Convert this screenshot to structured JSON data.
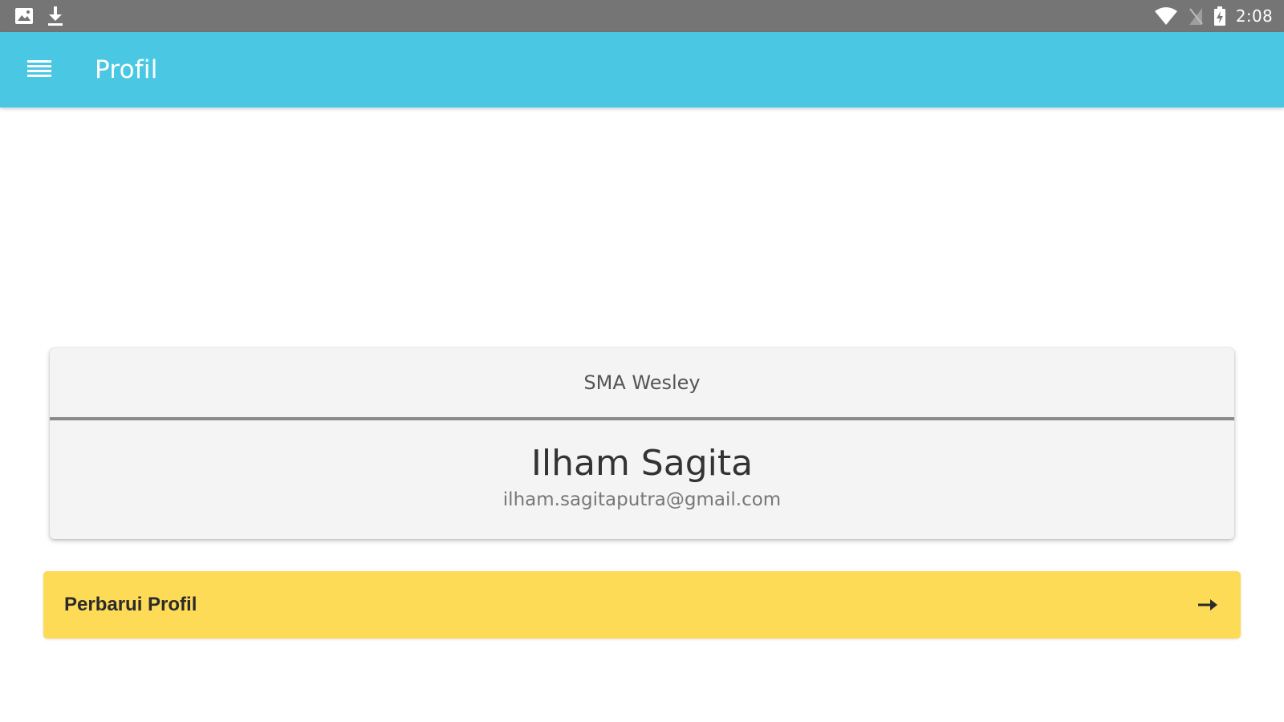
{
  "status_bar": {
    "time": "2:08",
    "left_icons": [
      "image-notification-icon",
      "download-icon"
    ],
    "right_icons": [
      "wifi-icon",
      "no-sim-icon",
      "battery-charging-icon"
    ]
  },
  "app_bar": {
    "menu_icon": "menu-icon",
    "title": "Profil",
    "background_color": "#4AC8E3"
  },
  "profile": {
    "school": "SMA Wesley",
    "name": "Ilham Sagita",
    "email": "ilham.sagitaputra@gmail.com"
  },
  "actions": {
    "update_profile_label": "Perbarui Profil",
    "update_profile_icon": "arrow-right-icon",
    "button_color": "#FDDB56"
  }
}
